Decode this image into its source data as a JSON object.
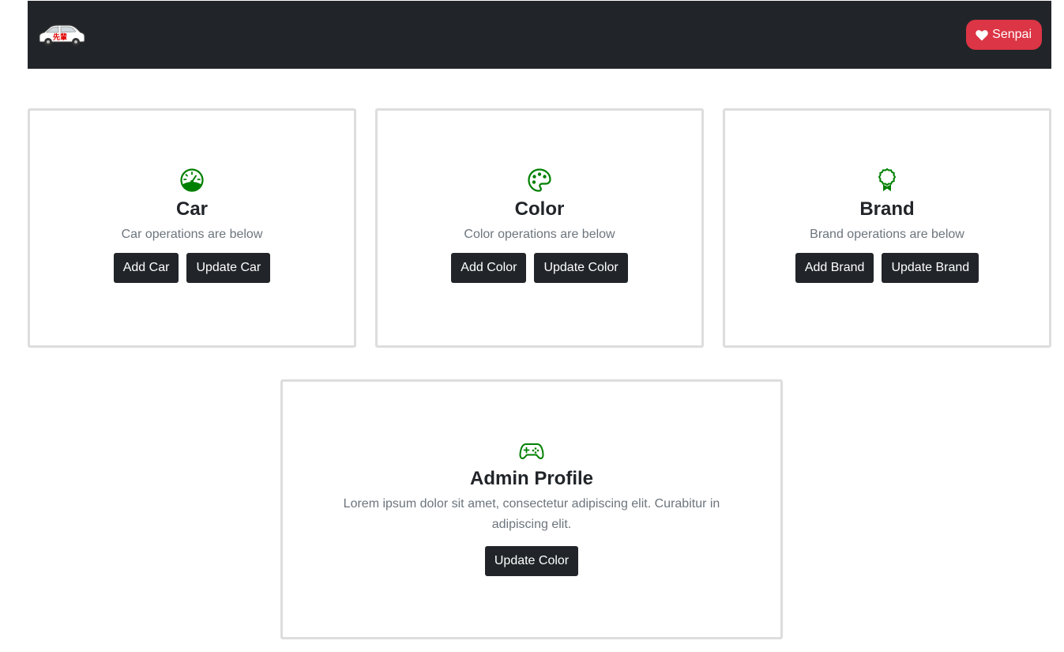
{
  "navbar": {
    "logo_icon": "car-logo-icon",
    "logo_text": "先輩",
    "senpai_label": "Senpai",
    "senpai_icon": "heart-icon",
    "bg_color": "#212529",
    "senpai_color": "#dc3545"
  },
  "cards": {
    "car": {
      "icon": "speedometer-icon",
      "title": "Car",
      "text": "Car operations are below",
      "buttons": [
        "Add Car",
        "Update Car"
      ]
    },
    "color": {
      "icon": "palette-icon",
      "title": "Color",
      "text": "Color operations are below",
      "buttons": [
        "Add Color",
        "Update Color"
      ]
    },
    "brand": {
      "icon": "award-icon",
      "title": "Brand",
      "text": "Brand operations are below",
      "buttons": [
        "Add Brand",
        "Update Brand"
      ]
    },
    "admin": {
      "icon": "controller-icon",
      "title": "Admin Profile",
      "text": "Lorem ipsum dolor sit amet, consectetur adipiscing elit. Curabitur in adipiscing elit.",
      "buttons": [
        "Update Color"
      ]
    }
  },
  "colors": {
    "icon_green": "#008000",
    "button_dark": "#212529",
    "card_border": "#dddddd",
    "muted_text": "#6c757d"
  }
}
